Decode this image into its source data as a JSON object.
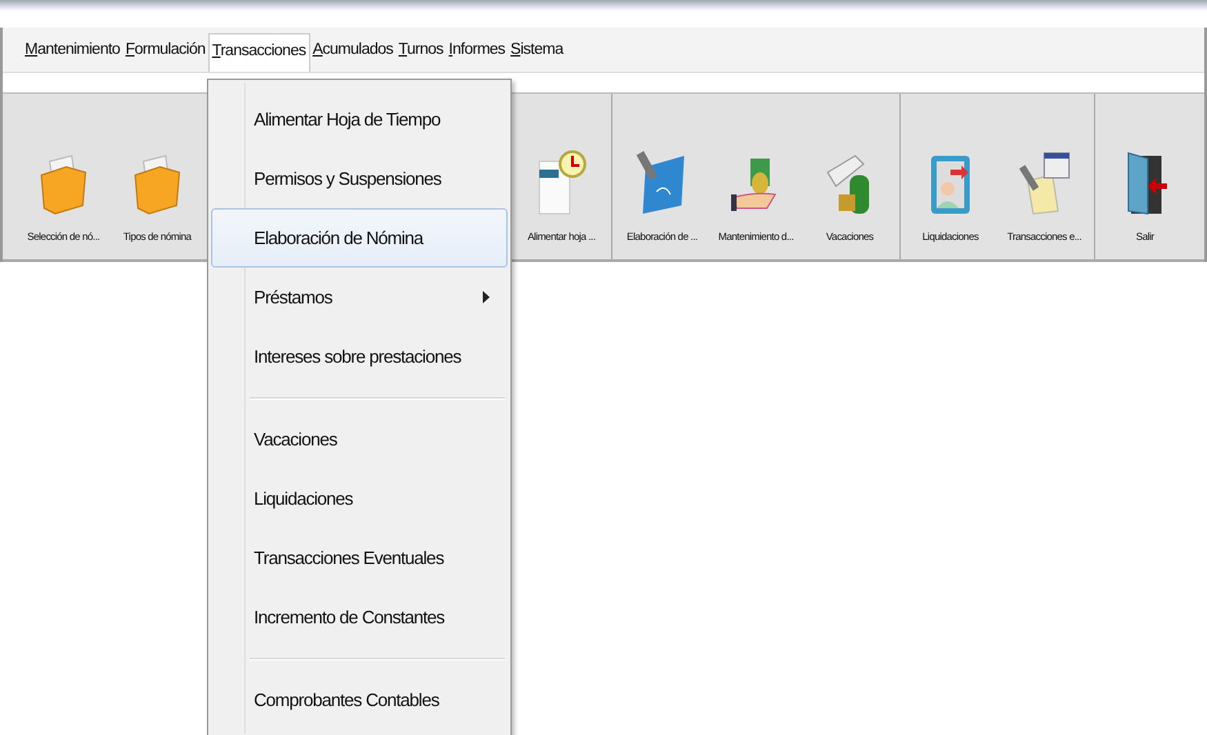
{
  "menu_bar": [
    {
      "label": "Mantenimiento",
      "selected": false
    },
    {
      "label": "Formulación",
      "selected": false
    },
    {
      "label": "Transacciones",
      "selected": true
    },
    {
      "label": "Acumulados",
      "selected": false
    },
    {
      "label": "Turnos",
      "selected": false
    },
    {
      "label": "Informes",
      "selected": false
    },
    {
      "label": "Sistema",
      "selected": false
    }
  ],
  "toolbar": [
    {
      "buttons": [
        {
          "label": "Selección de nó...",
          "kind": "folder"
        },
        {
          "label": "Tipos de nómina",
          "kind": "folder"
        }
      ]
    },
    {
      "buttons": [
        {
          "label": "Alimentar hoja ...",
          "kind": "clock-page"
        }
      ]
    },
    {
      "buttons": [
        {
          "label": "Elaboración de ...",
          "kind": "pen-sheet"
        },
        {
          "label": "Mantenimiento d...",
          "kind": "money-hand"
        },
        {
          "label": "Vacaciones",
          "kind": "luggage"
        }
      ]
    },
    {
      "buttons": [
        {
          "label": "Liquidaciones",
          "kind": "person-card"
        },
        {
          "label": "Transacciones e...",
          "kind": "calendar-sheet"
        }
      ]
    },
    {
      "buttons": [
        {
          "label": "Salir",
          "kind": "exit-door"
        }
      ]
    }
  ],
  "dropdown": [
    {
      "kind": "item",
      "label": "Alimentar Hoja de Tiempo",
      "selected": false
    },
    {
      "kind": "item",
      "label": "Permisos y Suspensiones",
      "selected": false
    },
    {
      "kind": "item",
      "label": "Elaboración de Nómina",
      "selected": true
    },
    {
      "kind": "submenu",
      "label": "Préstamos",
      "selected": false
    },
    {
      "kind": "item",
      "label": "Intereses sobre prestaciones",
      "selected": false
    },
    {
      "kind": "separator"
    },
    {
      "kind": "item",
      "label": "Vacaciones",
      "selected": false
    },
    {
      "kind": "item",
      "label": "Liquidaciones",
      "selected": false
    },
    {
      "kind": "item",
      "label": "Transacciones Eventuales",
      "selected": false
    },
    {
      "kind": "item",
      "label": "Incremento de Constantes",
      "selected": false
    },
    {
      "kind": "separator"
    },
    {
      "kind": "item",
      "label": "Comprobantes Contables",
      "selected": false
    }
  ]
}
